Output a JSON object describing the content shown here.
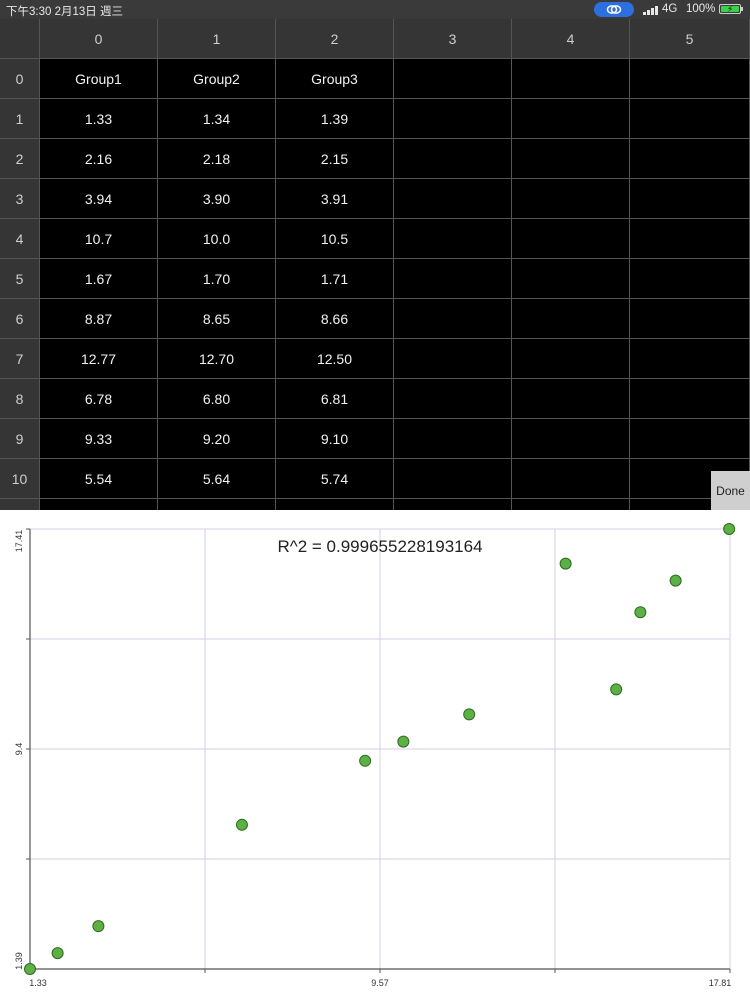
{
  "status_bar": {
    "time": "下午3:30   2月13日 週三",
    "network": "4G",
    "battery": "100%",
    "icons": [
      "hotspot-link-icon",
      "signal-bars-icon",
      "battery-charging-icon"
    ]
  },
  "sheet": {
    "column_headers": [
      "0",
      "1",
      "2",
      "3",
      "4",
      "5"
    ],
    "row_headers": [
      "0",
      "1",
      "2",
      "3",
      "4",
      "5",
      "6",
      "7",
      "8",
      "9",
      "10"
    ],
    "rows": [
      [
        "Group1",
        "Group2",
        "Group3",
        "",
        "",
        ""
      ],
      [
        "1.33",
        "1.34",
        "1.39",
        "",
        "",
        ""
      ],
      [
        "2.16",
        "2.18",
        "2.15",
        "",
        "",
        ""
      ],
      [
        "3.94",
        "3.90",
        "3.91",
        "",
        "",
        ""
      ],
      [
        "10.7",
        "10.0",
        "10.5",
        "",
        "",
        ""
      ],
      [
        "1.67",
        "1.70",
        "1.71",
        "",
        "",
        ""
      ],
      [
        "8.87",
        "8.65",
        "8.66",
        "",
        "",
        ""
      ],
      [
        "12.77",
        "12.70",
        "12.50",
        "",
        "",
        ""
      ],
      [
        "6.78",
        "6.80",
        "6.81",
        "",
        "",
        ""
      ],
      [
        "9.33",
        "9.20",
        "9.10",
        "",
        "",
        ""
      ],
      [
        "5.54",
        "5.64",
        "5.74",
        "",
        "",
        ""
      ]
    ],
    "done_label": "Done"
  },
  "chart_data": {
    "type": "scatter",
    "title": "R^2 = 0.999655228193164",
    "xlim": [
      1.33,
      17.81
    ],
    "ylim": [
      1.39,
      17.41
    ],
    "x_tick_labels": [
      "1.33",
      "9.57",
      "17.81"
    ],
    "y_tick_labels": [
      "1.39",
      "9.4",
      "17.41"
    ],
    "grid": true,
    "point_color": "#5db043",
    "points": [
      {
        "x": 1.33,
        "y": 1.39
      },
      {
        "x": 1.98,
        "y": 1.97
      },
      {
        "x": 2.94,
        "y": 2.95
      },
      {
        "x": 6.32,
        "y": 6.64
      },
      {
        "x": 9.22,
        "y": 8.97
      },
      {
        "x": 11.67,
        "y": 10.66
      },
      {
        "x": 15.7,
        "y": 14.38
      },
      {
        "x": 15.13,
        "y": 11.57
      },
      {
        "x": 16.53,
        "y": 15.53
      },
      {
        "x": 10.12,
        "y": 9.67
      },
      {
        "x": 13.94,
        "y": 16.15
      },
      {
        "x": 17.79,
        "y": 17.41
      }
    ]
  }
}
